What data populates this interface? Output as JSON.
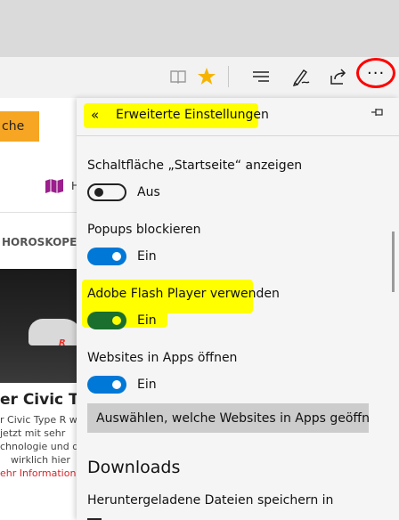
{
  "toolbar": {
    "icons": [
      "reading-view-icon",
      "favorite-star-icon",
      "hub-icon",
      "web-note-icon",
      "share-icon",
      "more-icon"
    ],
    "star_color": "#f6b400",
    "annotation_color": "#ff0000"
  },
  "background_page": {
    "search_button": "che",
    "nav_fragment": "H",
    "horoscope_tab": "HOROSKOPE",
    "car_badge": "R",
    "article_title": "er Civic Typ",
    "article_lines": [
      "r Civic Type R w",
      "jetzt mit sehr",
      "chnologie und de",
      "wirklich hier"
    ],
    "more_link": "ehr Informationen"
  },
  "panel": {
    "title": "Erweiterte Einstellungen",
    "highlight_color": "#ffff00",
    "settings": [
      {
        "label": "Schaltfläche „Startseite“ anzeigen",
        "state": "Aus",
        "on": false
      },
      {
        "label": "Popups blockieren",
        "state": "Ein",
        "on": true
      },
      {
        "label": "Adobe Flash Player verwenden",
        "state": "Ein",
        "on": true
      },
      {
        "label": "Websites in Apps öffnen",
        "state": "Ein",
        "on": true
      }
    ],
    "apps_button": "Auswählen, welche Websites in Apps geöffnet w",
    "downloads_heading": "Downloads",
    "downloads_label": "Heruntergeladene Dateien speichern in"
  }
}
